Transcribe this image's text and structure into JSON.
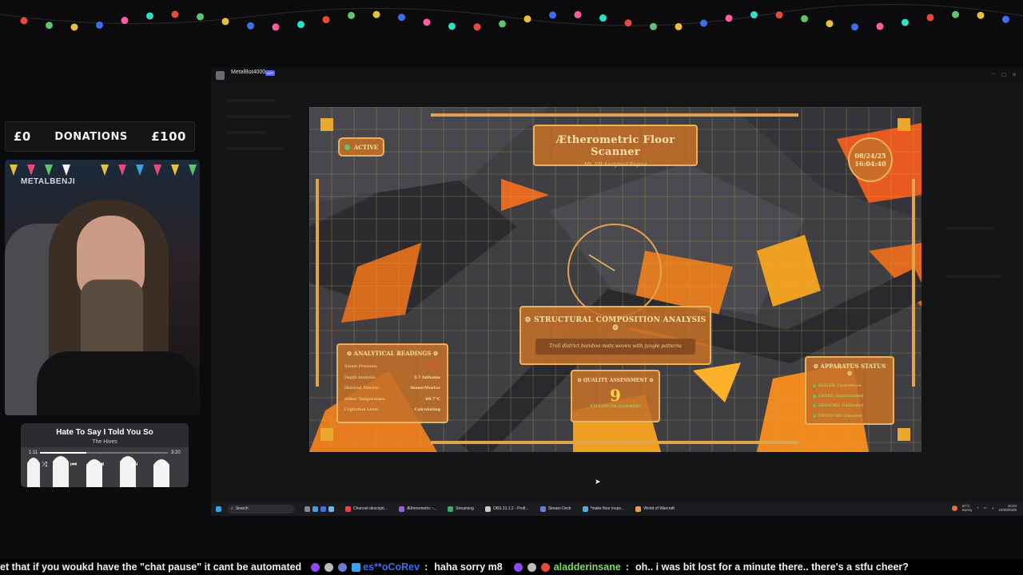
{
  "donations": {
    "min": "£0",
    "label": "DONATIONS",
    "max": "£100",
    "progress": 0
  },
  "webcam": {
    "logo_text": "METALBENJI"
  },
  "now_playing": {
    "title": "Hate To Say I Told You So",
    "artist": "The Hives",
    "elapsed": "1:11",
    "duration": "3:20",
    "progress": 0.36
  },
  "window": {
    "app_name": "MetalBot4000",
    "app_badge": "APP"
  },
  "scanner": {
    "title": "Ætherometric Floor Scanner",
    "subtitle": "Mk. VII Analytical Engine",
    "status": "ACTIVE",
    "clock_date": "08/24/25",
    "clock_time": "16:04:40",
    "composition": {
      "title": "⚙ STRUCTURAL COMPOSITION ANALYSIS ⚙",
      "description": "Troll district bamboo mats woven with jungle patterns"
    },
    "readings": {
      "title": "⚙ ANALYTICAL READINGS ⚙",
      "rows": [
        {
          "label": "Steam Pressure:",
          "value": "90 PSI"
        },
        {
          "label": "Depth Analysis:",
          "value": "3.7 fathoms"
        },
        {
          "label": "Material Density:",
          "value": "Stone/Mortar"
        },
        {
          "label": "Aither Temperature:",
          "value": "69.7°C"
        },
        {
          "label": "Cogitation Level:",
          "value": "Calculating"
        }
      ]
    },
    "quality": {
      "title": "⚙ QUALITY ASSESSMENT ⚙",
      "value": "9",
      "subtitle": "STEAMPUNK FLOORING"
    },
    "apparatus": {
      "title": "⚙ APPARATUS STATUS ⚙",
      "items": [
        "BOILER: Operational",
        "GEARS: Synchronized",
        "SENSORS: Calibrated",
        "PRESSURE: Elevated"
      ]
    }
  },
  "taskbar": {
    "search_placeholder": "Search",
    "items": [
      {
        "label": "Channel descripti...",
        "color": "#e8453c"
      },
      {
        "label": "Ætherometric -...",
        "color": "#a35be8"
      },
      {
        "label": "Streaming",
        "color": "#3ca86a"
      },
      {
        "label": "OBS 31.1.2 - Profi...",
        "color": "#c9c9c9"
      },
      {
        "label": "Stream Deck",
        "color": "#6e7bd6"
      },
      {
        "label": "*make floor inspe...",
        "color": "#4ab0e0"
      },
      {
        "label": "World of Warcraft",
        "color": "#f0a030"
      }
    ],
    "weather_temp": "20°C",
    "weather_desc": "Sunny",
    "time": "16:04",
    "date": "24/08/2025"
  },
  "chat": {
    "lead": "et that if you woukd have the \"chat pause\" it cant be automated",
    "user1": "es**oCoRev",
    "msg1": "haha sorry m8",
    "user2": "aladderinsane",
    "msg2": "oh.. i was bit lost for a minute there.. there's a stfu cheer?"
  },
  "colors": {
    "accent": "#c4702c",
    "gold": "#e8b35c",
    "grid": "#c9a94a",
    "active_green": "#5fc46e",
    "alert_red": "#e84a3a"
  }
}
